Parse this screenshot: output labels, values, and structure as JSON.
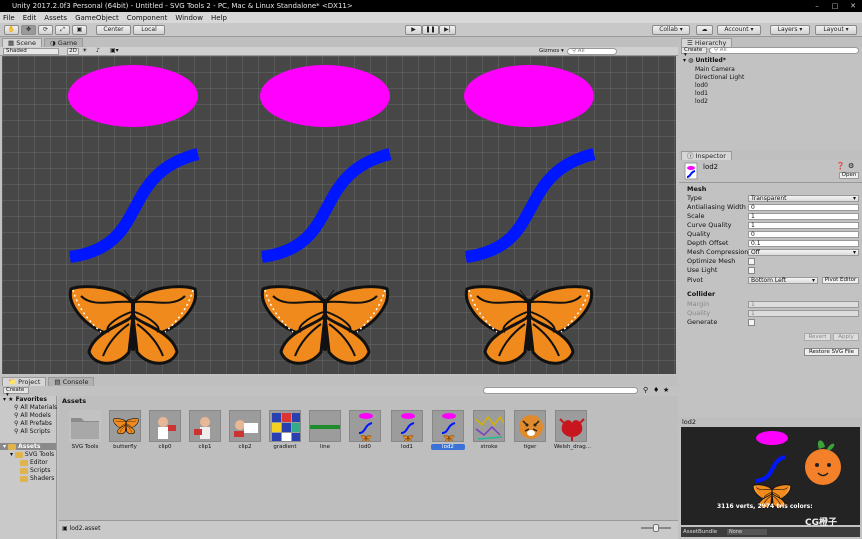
{
  "window": {
    "title": "Unity 2017.2.0f3 Personal (64bit) - Untitled - SVG Tools 2 - PC, Mac & Linux Standalone* <DX11>"
  },
  "menu": [
    "File",
    "Edit",
    "Assets",
    "GameObject",
    "Component",
    "Window",
    "Help"
  ],
  "toolbar": {
    "center": "Center",
    "local": "Local",
    "collab": "Collab ▾",
    "account": "Account ▾",
    "layers": "Layers ▾",
    "layout": "Layout ▾",
    "cloud": "☁"
  },
  "scene": {
    "tab_scene": "Scene",
    "tab_game": "Game",
    "shading": "Shaded",
    "mode_2d": "2D",
    "gizmos": "Gizmos ▾",
    "search": "All"
  },
  "hierarchy": {
    "title": "Hierarchy",
    "create": "Create ▾",
    "search": "All",
    "scene_name": "Untitled*",
    "items": [
      "Main Camera",
      "Directional Light",
      "lod0",
      "lod1",
      "lod2"
    ]
  },
  "inspector": {
    "title": "Inspector",
    "object_name": "lod2",
    "open": "Open",
    "mesh_header": "Mesh",
    "fields": [
      {
        "label": "Type",
        "value": "Transparent"
      },
      {
        "label": "Antialiasing Width",
        "value": "0"
      },
      {
        "label": "Scale",
        "value": "1"
      },
      {
        "label": "Curve Quality",
        "value": "1"
      },
      {
        "label": "Quality",
        "value": "0"
      },
      {
        "label": "Depth Offset",
        "value": "0.1"
      },
      {
        "label": "Mesh Compression",
        "value": "Off"
      }
    ],
    "optimize_mesh": "Optimize Mesh",
    "use_light": "Use Light",
    "pivot_label": "Pivot",
    "pivot_value": "Bottom Left",
    "pivot_editor": "Pivot Editor",
    "collider_header": "Collider",
    "margin_label": "Margin",
    "margin_value": "1",
    "quality_label": "Quality",
    "quality_value": "1",
    "generate_label": "Generate",
    "revert": "Revert",
    "apply": "Apply",
    "restore": "Restore SVG File"
  },
  "preview": {
    "title": "lod2",
    "stats": "3116 verts, 2974 tris  colors:",
    "asset_bundle_label": "AssetBundle",
    "asset_bundle_value": "None",
    "watermark": "CG橙子"
  },
  "project": {
    "tab_project": "Project",
    "tab_console": "Console",
    "create": "Create ▾",
    "favorites": "Favorites",
    "favorite_items": [
      "All Materials",
      "All Models",
      "All Prefabs",
      "All Scripts"
    ],
    "assets_root": "Assets",
    "tree": [
      "SVG Tools",
      "Editor",
      "Scripts",
      "Shaders"
    ],
    "breadcrumb": "Assets",
    "assets": [
      "SVG Tools",
      "butterfly",
      "clip0",
      "clip1",
      "clip2",
      "gradient",
      "line",
      "lod0",
      "lod1",
      "lod2",
      "stroke",
      "tiger",
      "Welsh_drag..."
    ],
    "footer": "lod2.asset"
  },
  "colors": {
    "ellipse": "#ff00ff",
    "curve": "#0016ff",
    "butterfly": "#f08a1c"
  }
}
